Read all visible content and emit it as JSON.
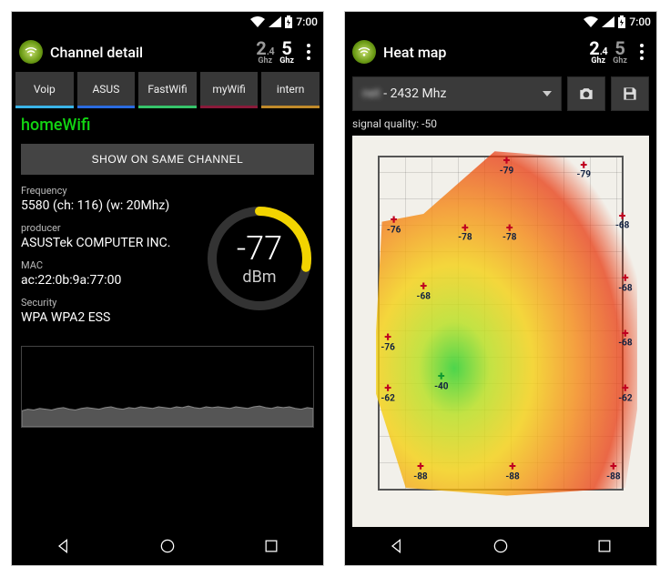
{
  "status": {
    "time": "7:00"
  },
  "left": {
    "title": "Channel detail",
    "freq24": {
      "big": "2",
      "sub": ".4",
      "unit": "Ghz",
      "active": false
    },
    "freq5": {
      "big": "5",
      "sub": "",
      "unit": "Ghz",
      "active": true
    },
    "tabs": [
      {
        "label": "Voip",
        "color": "#3ab4e8"
      },
      {
        "label": "ASUS",
        "color": "#2a6be0"
      },
      {
        "label": "FastWifi",
        "color": "#36c46a"
      },
      {
        "label": "myWifi",
        "color": "#8a1a3a"
      },
      {
        "label": "intern",
        "color": "#c08a2a"
      }
    ],
    "network_name": "homeWifi",
    "show_same_channel": "SHOW ON SAME CHANNEL",
    "details": {
      "frequency_label": "Frequency",
      "frequency_value": "5580 (ch: 116) (w: 20Mhz)",
      "producer_label": "producer",
      "producer_value": "ASUSTek COMPUTER INC.",
      "mac_label": "MAC",
      "mac_value": "ac:22:0b:9a:77:00",
      "security_label": "Security",
      "security_value": "WPA WPA2 ESS"
    },
    "signal": {
      "value": "-77",
      "unit": "dBm",
      "gauge_fraction": 0.28,
      "gauge_color": "#f2d400"
    },
    "chart_data": {
      "type": "area",
      "title": "",
      "xlabel": "",
      "ylabel": "",
      "ylim": [
        -100,
        0
      ],
      "values": [
        -80,
        -78,
        -79,
        -77,
        -78,
        -79,
        -77,
        -76,
        -78,
        -79,
        -77,
        -76,
        -77,
        -78,
        -76,
        -75,
        -77,
        -78,
        -76,
        -77,
        -75,
        -76,
        -77,
        -75,
        -76,
        -77,
        -75,
        -76,
        -74,
        -76,
        -77,
        -75,
        -76,
        -75,
        -76,
        -77,
        -75,
        -76,
        -77,
        -75,
        -74,
        -76,
        -77,
        -75,
        -76,
        -75,
        -77,
        -78,
        -76,
        -77
      ]
    }
  },
  "right": {
    "title": "Heat map",
    "freq24": {
      "big": "2",
      "sub": ".4",
      "unit": "Ghz",
      "active": true
    },
    "freq5": {
      "big": "5",
      "sub": "",
      "unit": "Ghz",
      "active": false
    },
    "dropdown_prefix": "net",
    "dropdown_suffix": " - 2432 Mhz",
    "signal_quality_label": "signal quality: -50",
    "heat_points": [
      {
        "x": 52,
        "y": 8,
        "v": "-79"
      },
      {
        "x": 78,
        "y": 9,
        "v": "-79"
      },
      {
        "x": 14,
        "y": 23,
        "v": "-76"
      },
      {
        "x": 38,
        "y": 25,
        "v": "-78"
      },
      {
        "x": 53,
        "y": 25,
        "v": "-78"
      },
      {
        "x": 91,
        "y": 22,
        "v": "-68"
      },
      {
        "x": 24,
        "y": 40,
        "v": "-68"
      },
      {
        "x": 92,
        "y": 38,
        "v": "-68"
      },
      {
        "x": 12,
        "y": 53,
        "v": "-76"
      },
      {
        "x": 92,
        "y": 52,
        "v": "-68"
      },
      {
        "x": 12,
        "y": 66,
        "v": "-62"
      },
      {
        "x": 92,
        "y": 66,
        "v": "-62"
      },
      {
        "x": 30,
        "y": 63,
        "v": "-40",
        "green": true
      },
      {
        "x": 23,
        "y": 86,
        "v": "-88"
      },
      {
        "x": 54,
        "y": 86,
        "v": "-88"
      },
      {
        "x": 88,
        "y": 86,
        "v": "-88"
      }
    ]
  }
}
